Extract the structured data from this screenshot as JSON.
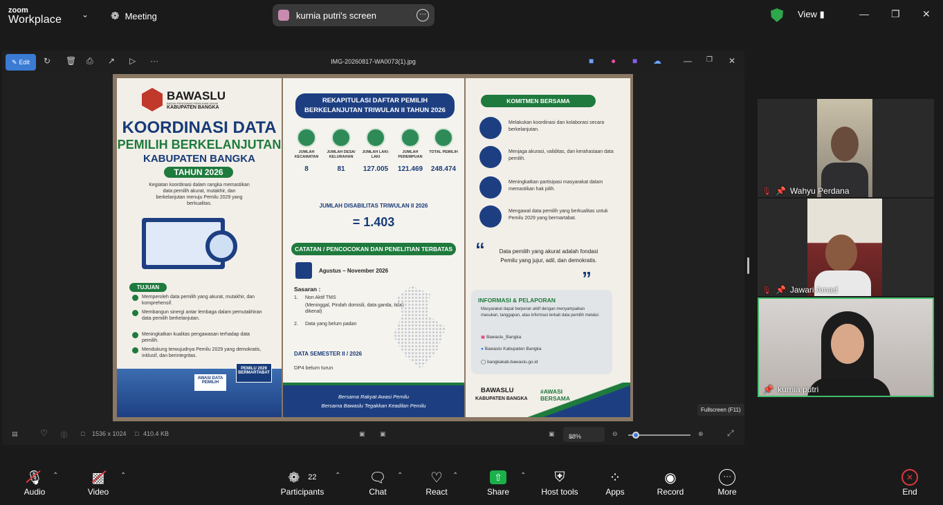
{
  "app": {
    "brand_top": "zoom",
    "brand_bottom": "Workplace",
    "meeting_label": "Meeting",
    "share_title": "kurnia putri's screen",
    "view_label": "View"
  },
  "viewer": {
    "edit_label": "Edit",
    "filename": "IMG-20260817-WA0073(1).jpg",
    "dimensions": "1536 x 1024",
    "filesize": "410.4 KB",
    "zoom": "88%",
    "zoom_level": 0.12,
    "fullscreen_tip": "Fullscreen (F11)"
  },
  "poster": {
    "left": {
      "org": "BAWASLU",
      "org_sub": "BADAN PENGAWAS PEMILIHAN UMUM",
      "org_region": "KABUPATEN BANGKA",
      "title1": "KOORDINASI DATA",
      "title2": "PEMILIH BERKELANJUTAN",
      "title3": "KABUPATEN BANGKA",
      "year": "TAHUN 2026",
      "intro": "Kegiatan koordinasi dalam rangka memastikan data pemilih akurat, mutakhir, dan berkelanjutan menuju Pemilu 2029 yang berkualitas.",
      "tujuan_label": "TUJUAN",
      "tujuan": [
        "Memperoleh data pemilih yang akurat, mutakhir, dan komprehensif.",
        "Membangun sinergi antar lembaga dalam pemutakhiran data pemilih berkelanjutan.",
        "Meningkatkan kualitas pengawasan terhadap data pemilih.",
        "Mendukung terwujudnya Pemilu 2029 yang demokratis, inklusif, dan berintegritas."
      ],
      "sign1": "AWASI DATA PEMILIH",
      "sign2": "PEMILU 2029 BERMARTABAT"
    },
    "middle": {
      "title": "REKAPITULASI DAFTAR PEMILIH BERKELANJUTAN TRIWULAN II TAHUN 2026",
      "stats": [
        {
          "label": "JUMLAH KECAMATAN",
          "value": "8"
        },
        {
          "label": "JUMLAH DESA/ KELURAHAN",
          "value": "81"
        },
        {
          "label": "JUMLAH LAKI-LAKI",
          "value": "127.005"
        },
        {
          "label": "JUMLAH PEREMPUAN",
          "value": "121.469"
        },
        {
          "label": "TOTAL PEMILIH",
          "value": "248.474"
        }
      ],
      "disabilitas_label": "JUMLAH DISABILITAS TRIWULAN II 2026",
      "disabilitas_value": "= 1.403",
      "catatan_label": "CATATAN / PENCOCOKAN DAN PENELITIAN TERBATAS",
      "period": "Agustus – November 2026",
      "sasaran_label": "Sasaran :",
      "sasaran1_num": "1.",
      "sasaran1": "Non Aktif TMS",
      "sasaran1_detail": "(Meninggal, Pindah domisili, data ganda, tidak dikenal)",
      "sasaran2_num": "2.",
      "sasaran2": "Data yang belum padan",
      "semester_label": "DATA SEMESTER II / 2026",
      "semester_text": "DP4 belum turun",
      "footer1": "Bersama Rakyat Awasi Pemilu",
      "footer2": "Bersama Bawaslu Tegakkan Keadilan Pemilu"
    },
    "right": {
      "komitmen_label": "KOMITMEN BERSAMA",
      "komitmen": [
        "Melakukan koordinasi dan kolaborasi secara berkelanjutan.",
        "Menjaga akurasi, validitas, dan kerahasiaan data pemilih.",
        "Meningkatkan partisipasi masyarakat dalam memastikan hak pilih.",
        "Mengawal data pemilih yang berkualitas untuk Pemilu 2029 yang bermartabat."
      ],
      "quote": "Data pemilih yang akurat adalah fondasi Pemilu yang jujur, adil, dan demokratis.",
      "info_label": "INFORMASI & PELAPORAN",
      "info_text": "Masyarakat dapat berperan aktif dengan menyampaikan masukan, tanggapan, atau informasi terkait data pemilih melalui:",
      "instagram": "Bawaslu_Bangka",
      "facebook": "Bawaslu Kabupaten Bangka",
      "website": "bangkakab.bawaslu.go.id",
      "footer_org": "BAWASLU",
      "footer_region": "KABUPATEN BANGKA",
      "hashtag": "#AWASI BERSAMA"
    }
  },
  "participants": [
    {
      "name": "Wahyu Perdana",
      "muted": true
    },
    {
      "name": "Jawari Amad",
      "muted": true
    },
    {
      "name": "kurnia putri",
      "muted": false
    }
  ],
  "toolbar": {
    "audio": "Audio",
    "video": "Video",
    "participants": "Participants",
    "participants_count": "22",
    "chat": "Chat",
    "react": "React",
    "share": "Share",
    "host_tools": "Host tools",
    "apps": "Apps",
    "record": "Record",
    "more": "More",
    "end": "End"
  },
  "colors": {
    "share_green": "#1bb04a",
    "end_red": "#e0393e",
    "active_speaker": "#3fbf6a",
    "edit_blue": "#3b7bd4"
  }
}
